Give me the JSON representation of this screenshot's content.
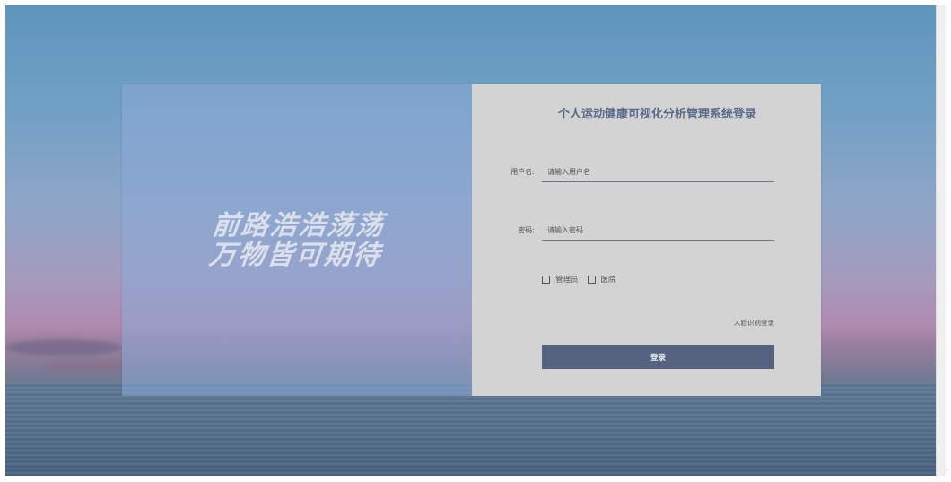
{
  "slogan": {
    "line1": "前路浩浩荡荡",
    "line2": "万物皆可期待"
  },
  "login_form": {
    "title": "个人运动健康可视化分析管理系统登录",
    "username": {
      "label": "用户名:",
      "value": "",
      "placeholder": "请输入用户名"
    },
    "password": {
      "label": "密码:",
      "value": "",
      "placeholder": "请输入密码"
    },
    "roles": [
      {
        "label": "管理员",
        "checked": false
      },
      {
        "label": "医院",
        "checked": false
      }
    ],
    "face_login_link": "人脸识别登录",
    "submit_label": "登录"
  },
  "colors": {
    "button_bg": "#566380",
    "form_bg": "#d3d3d3",
    "title_color": "#5a6a8a",
    "left_panel_tint": "#8caad7"
  }
}
